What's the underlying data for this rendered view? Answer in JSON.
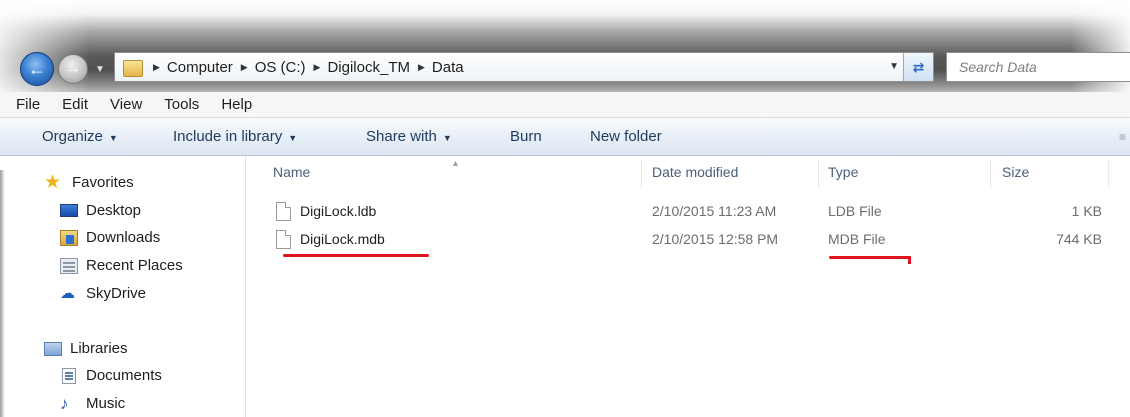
{
  "address_bar": {
    "breadcrumbs": [
      "Computer",
      "OS (C:)",
      "Digilock_TM",
      "Data"
    ]
  },
  "search": {
    "placeholder": "Search Data"
  },
  "menu": [
    "File",
    "Edit",
    "View",
    "Tools",
    "Help"
  ],
  "commands": {
    "organize": "Organize",
    "include_in_library": "Include in library",
    "share_with": "Share with",
    "burn": "Burn",
    "new_folder": "New folder"
  },
  "nav": {
    "favorites": "Favorites",
    "desktop": "Desktop",
    "downloads": "Downloads",
    "recent_places": "Recent Places",
    "skydrive": "SkyDrive",
    "libraries": "Libraries",
    "documents": "Documents",
    "music": "Music"
  },
  "columns": {
    "name": "Name",
    "date_modified": "Date modified",
    "type": "Type",
    "size": "Size"
  },
  "files": [
    {
      "name": "DigiLock.ldb",
      "date": "2/10/2015 11:23 AM",
      "type": "LDB File",
      "size": "1 KB"
    },
    {
      "name": "DigiLock.mdb",
      "date": "2/10/2015 12:58 PM",
      "type": "MDB File",
      "size": "744 KB"
    }
  ],
  "colors": {
    "annotation": "#e0141e",
    "accent": "#2b6bc0"
  },
  "icons": {
    "back": "arrow-left-icon",
    "forward": "arrow-right-icon",
    "refresh": "refresh-icon",
    "favorites": "star-icon"
  }
}
